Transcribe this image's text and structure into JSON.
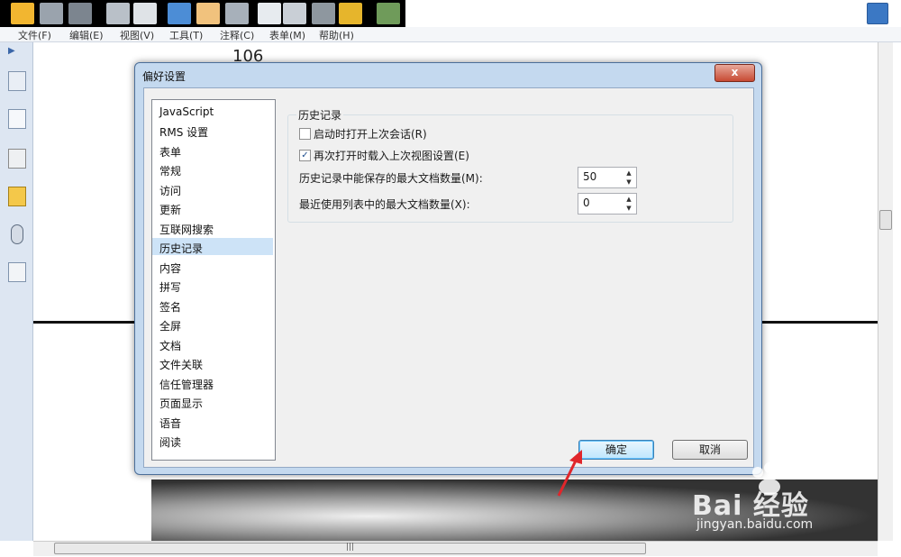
{
  "menubar": {
    "items": [
      "文件(F)",
      "编辑(E)",
      "视图(V)",
      "工具(T)",
      "注释(C)",
      "表单(M)",
      "帮助(H)"
    ]
  },
  "document": {
    "page_number": "106"
  },
  "dialog": {
    "title": "偏好设置",
    "close_label": "x",
    "categories": [
      "JavaScript",
      "RMS 设置",
      "表单",
      "常规",
      "访问",
      "更新",
      "互联网搜索",
      "历史记录",
      "内容",
      "拼写",
      "签名",
      "全屏",
      "文档",
      "文件关联",
      "信任管理器",
      "页面显示",
      "语音",
      "阅读"
    ],
    "selected_category": "历史记录",
    "group_title": "历史记录",
    "options": [
      {
        "label": "启动时打开上次会话(R)",
        "checked": false
      },
      {
        "label": "再次打开时载入上次视图设置(E)",
        "checked": true
      }
    ],
    "numeric_fields": [
      {
        "label": "历史记录中能保存的最大文档数量(M):",
        "value": "50"
      },
      {
        "label": "最近使用列表中的最大文档数量(X):",
        "value": "0"
      }
    ],
    "ok_label": "确定",
    "cancel_label": "取消"
  },
  "watermark": {
    "brand": "Bai 经验",
    "url": "jingyan.baidu.com"
  },
  "colors": {
    "selection": "#cde3f7",
    "arrow": "#e0262b",
    "dialog_frame": "#c4d9ef"
  }
}
